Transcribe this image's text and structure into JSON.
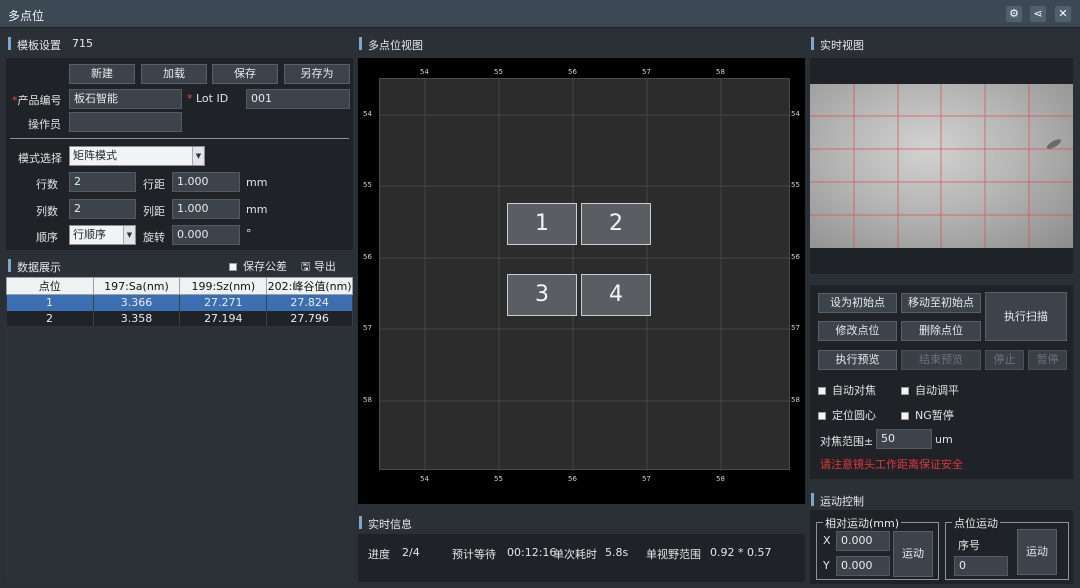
{
  "window": {
    "title": "多点位",
    "icons": [
      "settings-glasses-icon",
      "share-icon",
      "close-icon"
    ]
  },
  "template": {
    "header": "模板设置",
    "template_id": "715",
    "buttons": {
      "new": "新建",
      "load": "加载",
      "save": "保存",
      "save_as": "另存为"
    },
    "product_code_label": "产品编号",
    "product_code_value": "板石智能",
    "lot_label": "Lot ID",
    "lot_value": "001",
    "operator_label": "操作员",
    "operator_value": "",
    "mode_label": "模式选择",
    "mode_value": "矩阵模式",
    "rows_label": "行数",
    "rows_value": "2",
    "row_pitch_label": "行距",
    "row_pitch_value": "1.000",
    "cols_label": "列数",
    "cols_value": "2",
    "col_pitch_label": "列距",
    "col_pitch_value": "1.000",
    "unit_mm": "mm",
    "order_label": "顺序",
    "order_value": "行顺序",
    "rotation_label": "旋转",
    "rotation_value": "0.000",
    "unit_deg": "°"
  },
  "data_display": {
    "header": "数据展示",
    "save_tolerance": "保存公差",
    "export": "导出",
    "columns": [
      "点位",
      "197:Sa(nm)",
      "199:Sz(nm)",
      "202:峰谷值(nm)"
    ],
    "rows": [
      [
        "1",
        "3.366",
        "27.271",
        "27.824"
      ],
      [
        "2",
        "3.358",
        "27.194",
        "27.796"
      ]
    ]
  },
  "multi_view": {
    "header": "多点位视图",
    "x_ticks": [
      "54",
      "55",
      "56",
      "57",
      "58"
    ],
    "y_ticks": [
      "54",
      "55",
      "56",
      "57",
      "58"
    ],
    "points": [
      "1",
      "2",
      "3",
      "4"
    ]
  },
  "realtime_info": {
    "header": "实时信息",
    "progress_label": "进度",
    "progress_value": "2/4",
    "wait_label": "预计等待",
    "wait_value": "00:12:16",
    "single_label": "单次耗时",
    "single_value": "5.8s",
    "fov_label": "单视野范围",
    "fov_value": "0.92 * 0.57"
  },
  "live_view": {
    "header": "实时视图"
  },
  "scan": {
    "set_initial": "设为初始点",
    "move_initial": "移动至初始点",
    "execute_scan": "执行扫描",
    "modify_point": "修改点位",
    "delete_point": "删除点位",
    "execute_preview": "执行预览",
    "stop_preview": "结束预览",
    "stop": "停止",
    "pause": "暂停",
    "auto_focus": "自动对焦",
    "auto_level": "自动调平",
    "locate_center": "定位圆心",
    "ng_pause": "NG暂停",
    "focus_range_label": "对焦范围±",
    "focus_range_value": "50",
    "focus_unit": "um",
    "warning": "请注意镜头工作距离保证安全"
  },
  "motion": {
    "header": "运动控制",
    "relative_title": "相对运动(mm)",
    "x_label": "X",
    "x_value": "0.000",
    "y_label": "Y",
    "y_value": "0.000",
    "move_btn": "运动",
    "point_title": "点位运动",
    "seq_label": "序号",
    "seq_value": "0"
  },
  "colors": {
    "accent": "#7fa5c9",
    "selected_row": "#3c6fb2",
    "warning": "#e0353a",
    "grid_line_red": "#d9534f"
  }
}
